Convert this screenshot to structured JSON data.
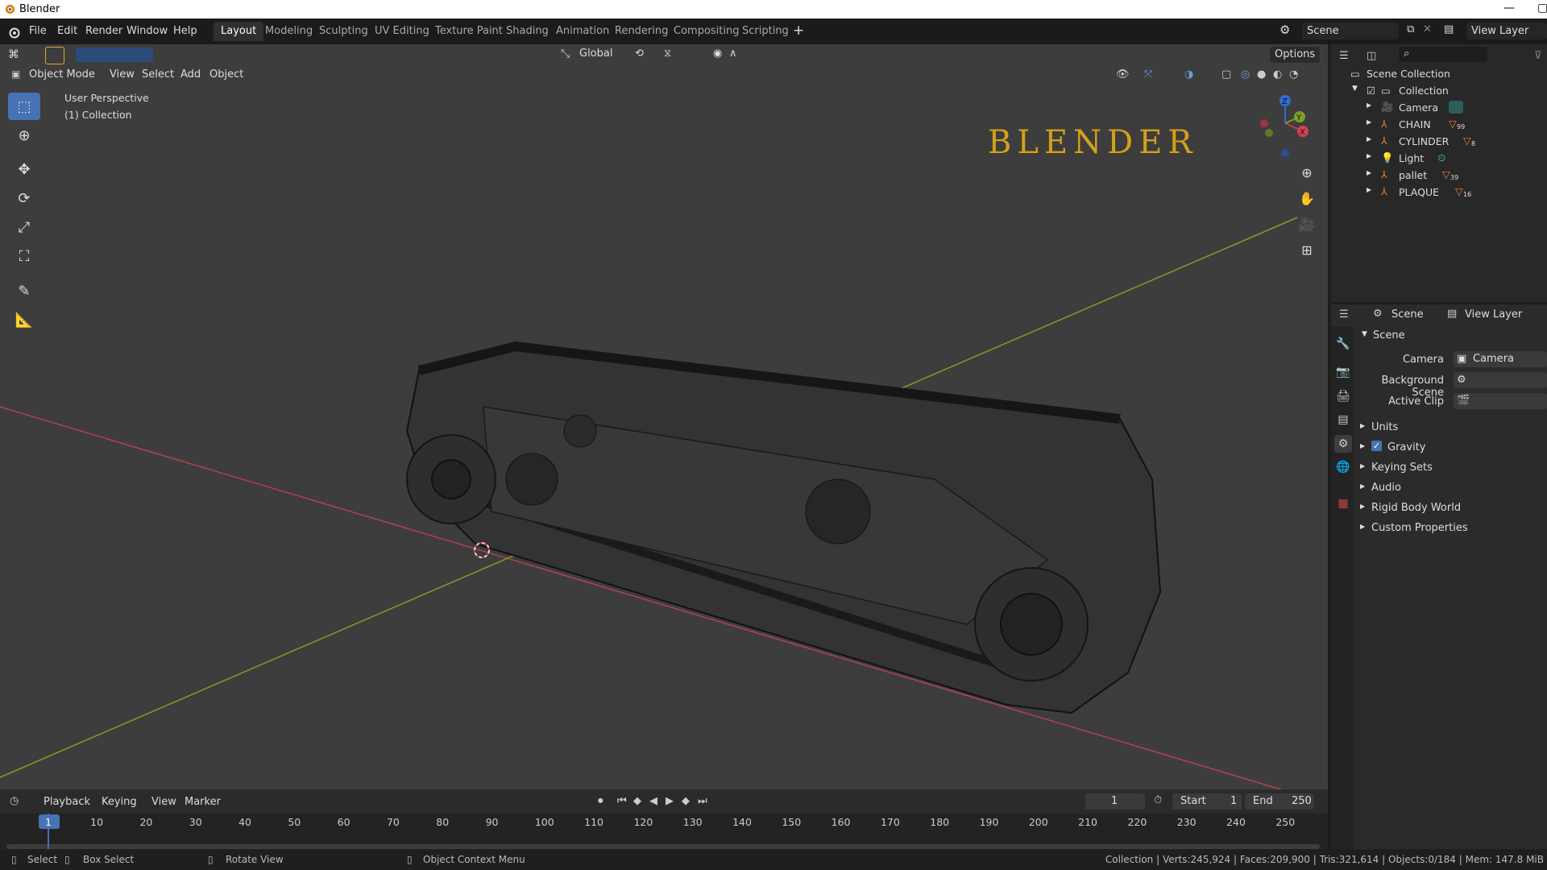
{
  "window": {
    "title": "Blender"
  },
  "menu": [
    "File",
    "Edit",
    "Render",
    "Window",
    "Help"
  ],
  "workspaces": [
    "Layout",
    "Modeling",
    "Sculpting",
    "UV Editing",
    "Texture Paint",
    "Shading",
    "Animation",
    "Rendering",
    "Compositing",
    "Scripting"
  ],
  "active_workspace": "Layout",
  "scene_selector": "Scene",
  "view_layer_selector": "View Layer",
  "toolbar_header": {
    "transform_orientation": "Global",
    "options": "Options"
  },
  "viewport_header": {
    "mode": "Object Mode",
    "menus": [
      "View",
      "Select",
      "Add",
      "Object"
    ]
  },
  "viewport": {
    "perspective": "User Perspective",
    "collection": "(1) Collection",
    "watermark": "BLENDER"
  },
  "gizmo": {
    "x": "X",
    "y": "Y",
    "z": "Z"
  },
  "outliner": {
    "root": "Scene Collection",
    "collection": "Collection",
    "items": [
      {
        "name": "Camera",
        "badge": ""
      },
      {
        "name": "CHAIN",
        "badge": "99"
      },
      {
        "name": "CYLINDER",
        "badge": "8"
      },
      {
        "name": "Light",
        "badge": ""
      },
      {
        "name": "pallet",
        "badge": "39"
      },
      {
        "name": "PLAQUE",
        "badge": "16"
      }
    ]
  },
  "properties": {
    "header_scene": "Scene",
    "header_view_layer": "View Layer",
    "panel_title": "Scene",
    "camera_label": "Camera",
    "camera_value": "Camera",
    "background_scene_label": "Background Scene",
    "active_clip_label": "Active Clip",
    "sections": [
      "Units",
      "Gravity",
      "Keying Sets",
      "Audio",
      "Rigid Body World",
      "Custom Properties"
    ]
  },
  "timeline": {
    "menus": [
      "Playback",
      "Keying",
      "View",
      "Marker"
    ],
    "current_frame": "1",
    "start_label": "Start",
    "start_value": "1",
    "end_label": "End",
    "end_value": "250",
    "ticks": [
      "1",
      "10",
      "20",
      "30",
      "40",
      "50",
      "60",
      "70",
      "80",
      "90",
      "100",
      "110",
      "120",
      "130",
      "140",
      "150",
      "160",
      "170",
      "180",
      "190",
      "200",
      "210",
      "220",
      "230",
      "240",
      "250"
    ]
  },
  "statusbar": {
    "select": "Select",
    "box_select": "Box Select",
    "rotate_view": "Rotate View",
    "context_menu": "Object Context Menu",
    "stats": "Collection | Verts:245,924 | Faces:209,900 | Tris:321,614 | Objects:0/184 | Mem: 147.8 MiB"
  },
  "colors": {
    "accent": "#4772b3",
    "x_axis": "#b2434f",
    "y_axis": "#7b9f2a",
    "watermark": "#d4a017"
  }
}
